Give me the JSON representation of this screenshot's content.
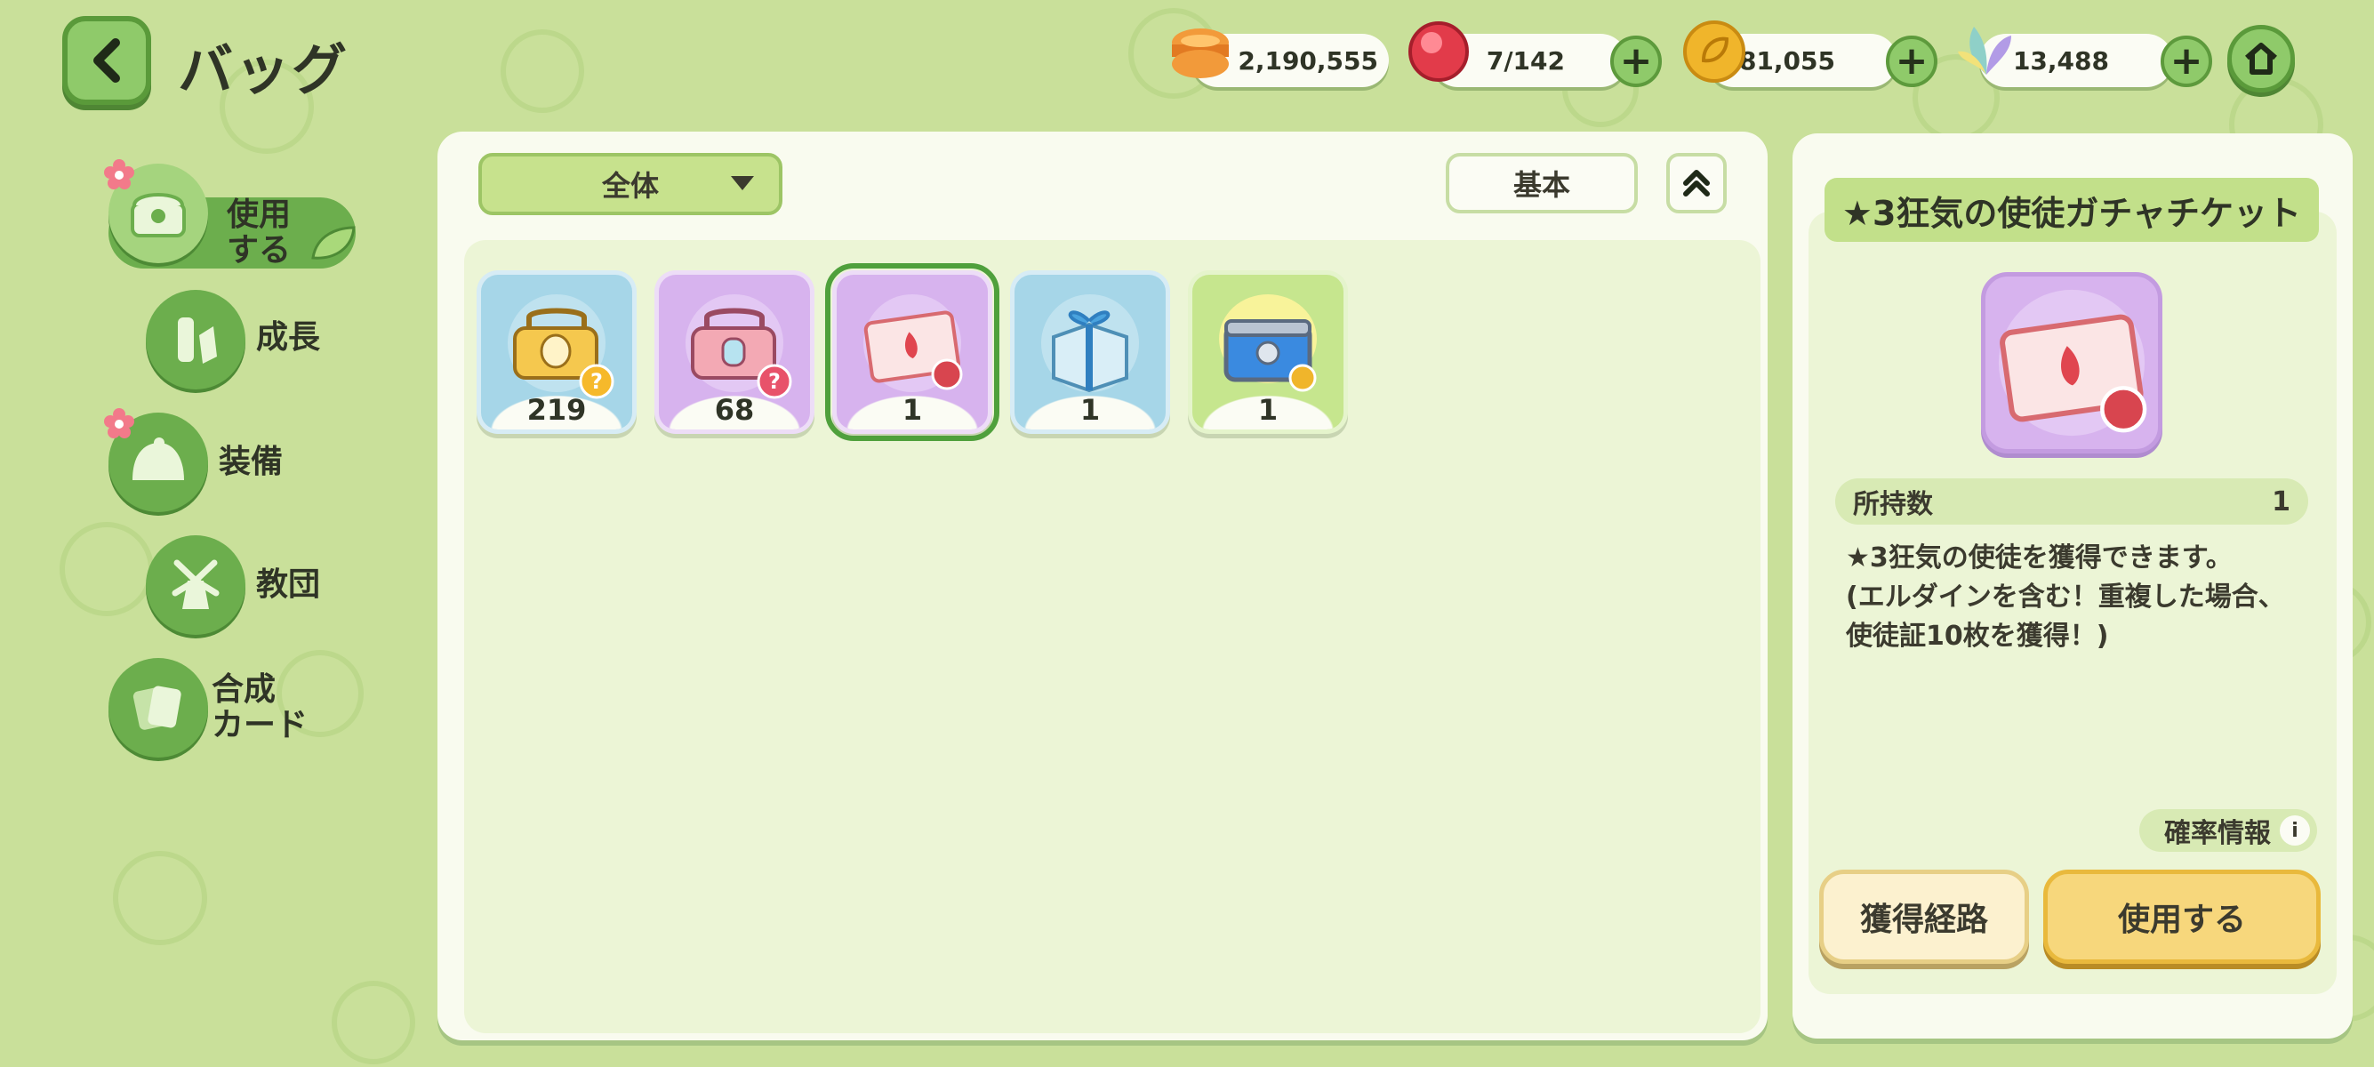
{
  "header": {
    "title": "バッグ",
    "currencies": [
      {
        "icon": "burger-coin-icon",
        "value": "2,190,555"
      },
      {
        "icon": "red-gem-icon",
        "value": "7/142"
      },
      {
        "icon": "gold-leaf-coin-icon",
        "value": "481,055"
      },
      {
        "icon": "crystal-leaf-icon",
        "value": "13,488"
      }
    ],
    "plus_label": "+"
  },
  "sidebar": {
    "items": [
      {
        "label": "使用\nする",
        "icon": "chest-icon",
        "active": true,
        "badge": true
      },
      {
        "label": "成長",
        "icon": "bottle-icon",
        "active": false,
        "badge": false
      },
      {
        "label": "装備",
        "icon": "cap-icon",
        "active": false,
        "badge": true
      },
      {
        "label": "教団",
        "icon": "windmill-icon",
        "active": false,
        "badge": false
      },
      {
        "label": "合成\nカード",
        "icon": "card-icon",
        "active": false,
        "badge": false
      }
    ]
  },
  "main": {
    "filter_label": "全体",
    "sort_label": "基本",
    "items": [
      {
        "icon": "gold-chest-icon",
        "count": "219",
        "color": "blue"
      },
      {
        "icon": "rainbow-chest-icon",
        "count": "68",
        "color": "purple"
      },
      {
        "icon": "gacha-ticket-icon",
        "count": "1",
        "color": "purple",
        "selected": true
      },
      {
        "icon": "ice-gift-box-icon",
        "count": "1",
        "color": "blue"
      },
      {
        "icon": "locked-blue-chest-icon",
        "count": "1",
        "color": "green"
      }
    ]
  },
  "detail": {
    "title": "★3狂気の使徒ガチャチケット",
    "owned_label": "所持数",
    "owned_value": "1",
    "description": "★3狂気の使徒を獲得できます。\n(エルダインを含む！重複した場合、使徒証10枚を獲得！)",
    "prob_label": "確率情報",
    "route_label": "獲得経路",
    "use_label": "使用する"
  },
  "colors": {
    "background": "#c9e09a",
    "accent_green": "#6cae4d",
    "use_button": "#f7d77c"
  }
}
